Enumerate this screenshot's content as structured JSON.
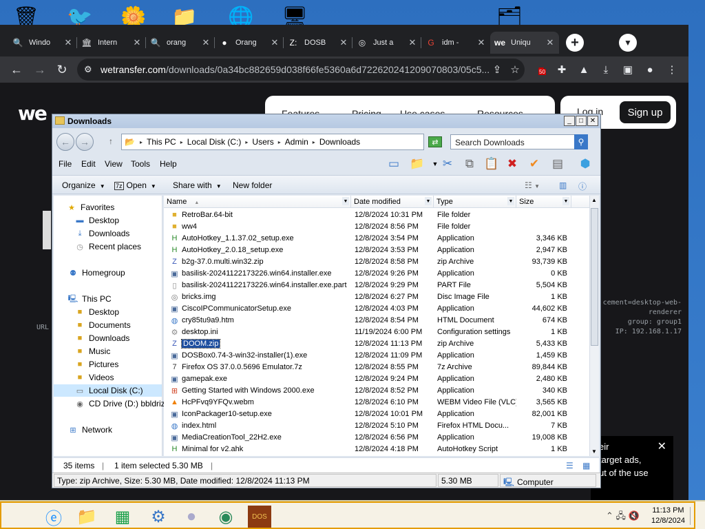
{
  "desktop": {
    "icons": [
      "recycle-bin",
      "bird",
      "flower",
      "folder",
      "network",
      "monitor",
      "zip"
    ]
  },
  "browser": {
    "tabs": [
      {
        "title": "Windo",
        "icon": "search-icon"
      },
      {
        "title": "Intern",
        "icon": "bank-icon"
      },
      {
        "title": "orang",
        "icon": "search-icon"
      },
      {
        "title": "Orang",
        "icon": "github-icon"
      },
      {
        "title": "DOSB",
        "icon": "z-icon"
      },
      {
        "title": "Just a",
        "icon": "globe-icon"
      },
      {
        "title": "idm - ",
        "icon": "google-icon"
      },
      {
        "title": "Uniqu",
        "icon": "we-icon"
      }
    ],
    "new_tab": "+",
    "url_host": "wetransfer.com",
    "url_path": "/downloads/0a34bc882659d038f66fe5360a6d72262024120907080​3/05c5...",
    "ext_badge": "50"
  },
  "page": {
    "logo": "we",
    "nav": [
      "Features",
      "Pricing",
      "Use cases",
      "Resources"
    ],
    "login": "Log in",
    "signup": "Sign up",
    "url_label": "URL",
    "side_lines": [
      "cement=desktop-web-",
      "renderer",
      "group: group1",
      "IP: 192.168.1.17"
    ],
    "cookie_lines": [
      "eir",
      "target ads,",
      "ut of the use"
    ]
  },
  "explorer": {
    "title": "Downloads",
    "breadcrumb": [
      "This PC",
      "Local Disk (C:)",
      "Users",
      "Admin",
      "Downloads"
    ],
    "search_placeholder": "Search Downloads",
    "menu": [
      "File",
      "Edit",
      "View",
      "Tools",
      "Help"
    ],
    "commands": {
      "organize": "Organize",
      "open": "Open",
      "share": "Share with",
      "new_folder": "New folder"
    },
    "nav": {
      "favorites": "Favorites",
      "fav_items": [
        "Desktop",
        "Downloads",
        "Recent places"
      ],
      "homegroup": "Homegroup",
      "thispc": "This PC",
      "pc_items": [
        "Desktop",
        "Documents",
        "Downloads",
        "Music",
        "Pictures",
        "Videos",
        "Local Disk (C:)",
        "CD Drive (D:) bbldrizzy"
      ],
      "network": "Network"
    },
    "columns": [
      "Name",
      "Date modified",
      "Type",
      "Size"
    ],
    "files": [
      {
        "name": "RetroBar.64-bit",
        "date": "12/8/2024 10:31 PM",
        "type": "File folder",
        "size": "",
        "icon": "folder-icon"
      },
      {
        "name": "ww4",
        "date": "12/8/2024 8:56 PM",
        "type": "File folder",
        "size": "",
        "icon": "folder-icon"
      },
      {
        "name": "AutoHotkey_1.1.37.02_setup.exe",
        "date": "12/8/2024 3:54 PM",
        "type": "Application",
        "size": "3,346 KB",
        "icon": "ahk-icon"
      },
      {
        "name": "AutoHotkey_2.0.18_setup.exe",
        "date": "12/8/2024 3:53 PM",
        "type": "Application",
        "size": "2,947 KB",
        "icon": "ahk-icon"
      },
      {
        "name": "b2g-37.0.multi.win32.zip",
        "date": "12/8/2024 8:58 PM",
        "type": "zip Archive",
        "size": "93,739 KB",
        "icon": "zip-icon"
      },
      {
        "name": "basilisk-20241122173226.win64.installer.exe",
        "date": "12/8/2024 9:26 PM",
        "type": "Application",
        "size": "0 KB",
        "icon": "exe-icon"
      },
      {
        "name": "basilisk-20241122173226.win64.installer.exe.part",
        "date": "12/8/2024 9:29 PM",
        "type": "PART File",
        "size": "5,504 KB",
        "icon": "file-icon"
      },
      {
        "name": "bricks.img",
        "date": "12/8/2024 6:27 PM",
        "type": "Disc Image File",
        "size": "1 KB",
        "icon": "disc-icon"
      },
      {
        "name": "CiscoIPCommunicatorSetup.exe",
        "date": "12/8/2024 4:03 PM",
        "type": "Application",
        "size": "44,602 KB",
        "icon": "exe-icon"
      },
      {
        "name": "cry85tu9a9.htm",
        "date": "12/8/2024 8:54 PM",
        "type": "HTML Document",
        "size": "674 KB",
        "icon": "html-icon"
      },
      {
        "name": "desktop.ini",
        "date": "11/19/2024 6:00 PM",
        "type": "Configuration settings",
        "size": "1 KB",
        "icon": "gear-icon"
      },
      {
        "name": "DOOM.zip",
        "date": "12/8/2024 11:13 PM",
        "type": "zip Archive",
        "size": "5,433 KB",
        "icon": "zip-icon",
        "selected": true
      },
      {
        "name": "DOSBox0.74-3-win32-installer(1).exe",
        "date": "12/8/2024 11:09 PM",
        "type": "Application",
        "size": "1,459 KB",
        "icon": "exe-icon"
      },
      {
        "name": "Firefox OS 37.0.0.5696 Emulator.7z",
        "date": "12/8/2024 8:55 PM",
        "type": "7z Archive",
        "size": "89,844 KB",
        "icon": "archive-icon"
      },
      {
        "name": "gamepak.exe",
        "date": "12/8/2024 9:24 PM",
        "type": "Application",
        "size": "2,480 KB",
        "icon": "exe-icon"
      },
      {
        "name": "Getting Started with Windows 2000.exe",
        "date": "12/8/2024 8:52 PM",
        "type": "Application",
        "size": "340 KB",
        "icon": "windows-icon"
      },
      {
        "name": "HcPFvq9YFQv.webm",
        "date": "12/8/2024 6:10 PM",
        "type": "WEBM Video File (VLC)",
        "size": "3,565 KB",
        "icon": "vlc-icon"
      },
      {
        "name": "IconPackager10-setup.exe",
        "date": "12/8/2024 10:01 PM",
        "type": "Application",
        "size": "82,001 KB",
        "icon": "exe-icon"
      },
      {
        "name": "index.html",
        "date": "12/8/2024 5:10 PM",
        "type": "Firefox HTML Docu...",
        "size": "7 KB",
        "icon": "html-icon"
      },
      {
        "name": "MediaCreationTool_22H2.exe",
        "date": "12/8/2024 6:56 PM",
        "type": "Application",
        "size": "19,008 KB",
        "icon": "exe-icon"
      },
      {
        "name": "Minimal for v2.ahk",
        "date": "12/8/2024 4:18 PM",
        "type": "AutoHotkey Script",
        "size": "1 KB",
        "icon": "ahk-icon"
      }
    ],
    "status": {
      "items": "35 items",
      "selected": "1 item selected  5.30 MB"
    },
    "statusbar": {
      "info": "Type: zip Archive, Size: 5.30 MB, Date modified: 12/8/2024 11:13 PM",
      "size": "5.30 MB",
      "location": "Computer"
    }
  },
  "taskbar": {
    "icons": [
      "ie-icon",
      "explorer-icon",
      "store-icon",
      "network-icon",
      "ball-icon",
      "browser-icon",
      "dosbox-icon"
    ],
    "time": "11:13 PM",
    "date": "12/8/2024"
  }
}
